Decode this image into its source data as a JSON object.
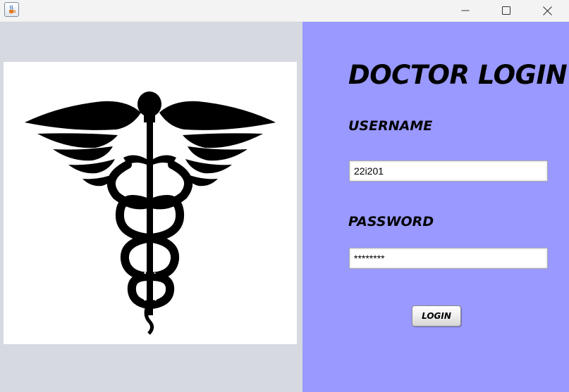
{
  "window": {
    "icon": "java-cup-icon",
    "controls": {
      "minimize_icon": "minimize-icon",
      "maximize_icon": "maximize-icon",
      "close_icon": "close-icon"
    }
  },
  "logo": {
    "icon": "caduceus-icon"
  },
  "form": {
    "title": "DOCTOR LOGIN",
    "username_label": "USERNAME",
    "username_value": "22i201",
    "password_label": "PASSWORD",
    "password_value": "********",
    "login_label": "LOGIN"
  },
  "colors": {
    "left_panel": "#d6d9e0",
    "right_panel": "#9999ff",
    "titlebar": "#f3f3f3"
  }
}
